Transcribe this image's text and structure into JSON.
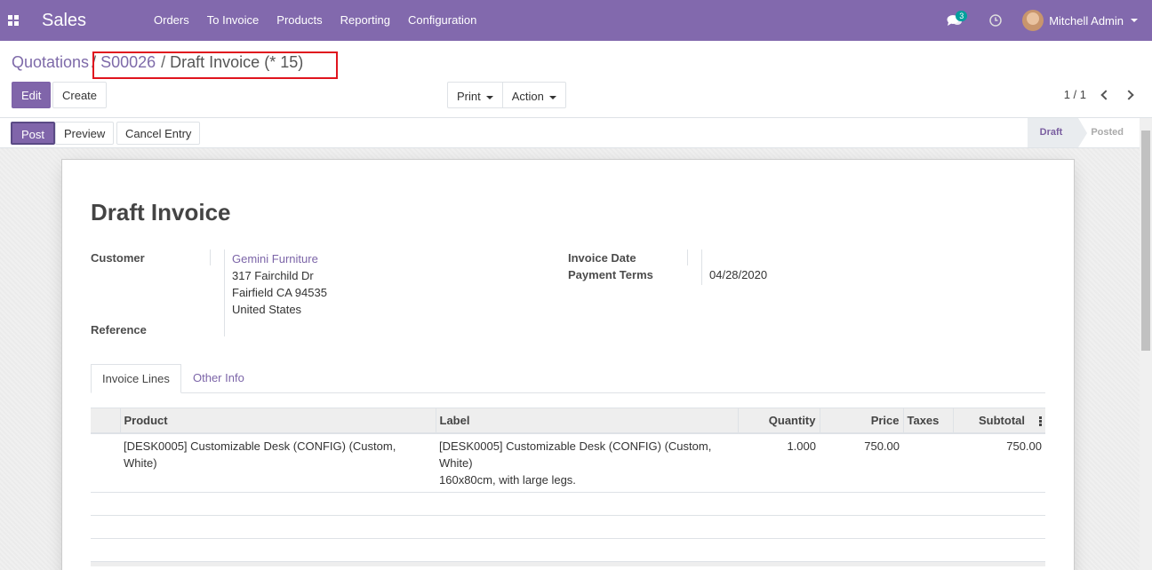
{
  "navbar": {
    "app_name": "Sales",
    "menu": [
      "Orders",
      "To Invoice",
      "Products",
      "Reporting",
      "Configuration"
    ],
    "messages_count": "3",
    "user_name": "Mitchell Admin"
  },
  "breadcrumb": {
    "items": [
      "Quotations",
      "S00026",
      "Draft Invoice (* 15)"
    ],
    "separator": "/"
  },
  "toolbar": {
    "edit_label": "Edit",
    "create_label": "Create",
    "print_label": "Print",
    "action_label": "Action",
    "pager": "1 / 1"
  },
  "statusbar": {
    "post_label": "Post",
    "preview_label": "Preview",
    "cancel_label": "Cancel Entry",
    "stages": [
      "Draft",
      "Posted"
    ],
    "active_stage": "Draft"
  },
  "invoice": {
    "title": "Draft Invoice",
    "customer_label": "Customer",
    "customer_name": "Gemini Furniture",
    "address": [
      "317 Fairchild Dr",
      "Fairfield CA 94535",
      "United States"
    ],
    "reference_label": "Reference",
    "invoice_date_label": "Invoice Date",
    "payment_terms_label": "Payment Terms",
    "date_value": "04/28/2020"
  },
  "tabs": [
    "Invoice Lines",
    "Other Info"
  ],
  "lines": {
    "headers": [
      "Product",
      "Label",
      "Quantity",
      "Price",
      "Taxes",
      "Subtotal"
    ],
    "rows": [
      {
        "product": "[DESK0005] Customizable Desk (CONFIG) (Custom, White)",
        "label_line1": "[DESK0005] Customizable Desk (CONFIG) (Custom,",
        "label_line2": "White)",
        "label_line3": "160x80cm, with large legs.",
        "quantity": "1.000",
        "price": "750.00",
        "taxes": "",
        "subtotal": "750.00"
      }
    ]
  },
  "colors": {
    "brand": "#8269ad",
    "link": "#7c65a8",
    "highlight": "#e0141e"
  }
}
